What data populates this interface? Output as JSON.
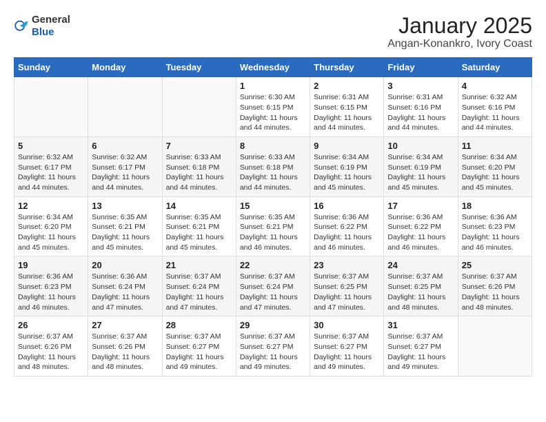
{
  "header": {
    "logo_general": "General",
    "logo_blue": "Blue",
    "title": "January 2025",
    "subtitle": "Angan-Konankro, Ivory Coast"
  },
  "weekdays": [
    "Sunday",
    "Monday",
    "Tuesday",
    "Wednesday",
    "Thursday",
    "Friday",
    "Saturday"
  ],
  "weeks": [
    [
      {
        "day": "",
        "info": ""
      },
      {
        "day": "",
        "info": ""
      },
      {
        "day": "",
        "info": ""
      },
      {
        "day": "1",
        "info": "Sunrise: 6:30 AM\nSunset: 6:15 PM\nDaylight: 11 hours\nand 44 minutes."
      },
      {
        "day": "2",
        "info": "Sunrise: 6:31 AM\nSunset: 6:15 PM\nDaylight: 11 hours\nand 44 minutes."
      },
      {
        "day": "3",
        "info": "Sunrise: 6:31 AM\nSunset: 6:16 PM\nDaylight: 11 hours\nand 44 minutes."
      },
      {
        "day": "4",
        "info": "Sunrise: 6:32 AM\nSunset: 6:16 PM\nDaylight: 11 hours\nand 44 minutes."
      }
    ],
    [
      {
        "day": "5",
        "info": "Sunrise: 6:32 AM\nSunset: 6:17 PM\nDaylight: 11 hours\nand 44 minutes."
      },
      {
        "day": "6",
        "info": "Sunrise: 6:32 AM\nSunset: 6:17 PM\nDaylight: 11 hours\nand 44 minutes."
      },
      {
        "day": "7",
        "info": "Sunrise: 6:33 AM\nSunset: 6:18 PM\nDaylight: 11 hours\nand 44 minutes."
      },
      {
        "day": "8",
        "info": "Sunrise: 6:33 AM\nSunset: 6:18 PM\nDaylight: 11 hours\nand 44 minutes."
      },
      {
        "day": "9",
        "info": "Sunrise: 6:34 AM\nSunset: 6:19 PM\nDaylight: 11 hours\nand 45 minutes."
      },
      {
        "day": "10",
        "info": "Sunrise: 6:34 AM\nSunset: 6:19 PM\nDaylight: 11 hours\nand 45 minutes."
      },
      {
        "day": "11",
        "info": "Sunrise: 6:34 AM\nSunset: 6:20 PM\nDaylight: 11 hours\nand 45 minutes."
      }
    ],
    [
      {
        "day": "12",
        "info": "Sunrise: 6:34 AM\nSunset: 6:20 PM\nDaylight: 11 hours\nand 45 minutes."
      },
      {
        "day": "13",
        "info": "Sunrise: 6:35 AM\nSunset: 6:21 PM\nDaylight: 11 hours\nand 45 minutes."
      },
      {
        "day": "14",
        "info": "Sunrise: 6:35 AM\nSunset: 6:21 PM\nDaylight: 11 hours\nand 45 minutes."
      },
      {
        "day": "15",
        "info": "Sunrise: 6:35 AM\nSunset: 6:21 PM\nDaylight: 11 hours\nand 46 minutes."
      },
      {
        "day": "16",
        "info": "Sunrise: 6:36 AM\nSunset: 6:22 PM\nDaylight: 11 hours\nand 46 minutes."
      },
      {
        "day": "17",
        "info": "Sunrise: 6:36 AM\nSunset: 6:22 PM\nDaylight: 11 hours\nand 46 minutes."
      },
      {
        "day": "18",
        "info": "Sunrise: 6:36 AM\nSunset: 6:23 PM\nDaylight: 11 hours\nand 46 minutes."
      }
    ],
    [
      {
        "day": "19",
        "info": "Sunrise: 6:36 AM\nSunset: 6:23 PM\nDaylight: 11 hours\nand 46 minutes."
      },
      {
        "day": "20",
        "info": "Sunrise: 6:36 AM\nSunset: 6:24 PM\nDaylight: 11 hours\nand 47 minutes."
      },
      {
        "day": "21",
        "info": "Sunrise: 6:37 AM\nSunset: 6:24 PM\nDaylight: 11 hours\nand 47 minutes."
      },
      {
        "day": "22",
        "info": "Sunrise: 6:37 AM\nSunset: 6:24 PM\nDaylight: 11 hours\nand 47 minutes."
      },
      {
        "day": "23",
        "info": "Sunrise: 6:37 AM\nSunset: 6:25 PM\nDaylight: 11 hours\nand 47 minutes."
      },
      {
        "day": "24",
        "info": "Sunrise: 6:37 AM\nSunset: 6:25 PM\nDaylight: 11 hours\nand 48 minutes."
      },
      {
        "day": "25",
        "info": "Sunrise: 6:37 AM\nSunset: 6:26 PM\nDaylight: 11 hours\nand 48 minutes."
      }
    ],
    [
      {
        "day": "26",
        "info": "Sunrise: 6:37 AM\nSunset: 6:26 PM\nDaylight: 11 hours\nand 48 minutes."
      },
      {
        "day": "27",
        "info": "Sunrise: 6:37 AM\nSunset: 6:26 PM\nDaylight: 11 hours\nand 48 minutes."
      },
      {
        "day": "28",
        "info": "Sunrise: 6:37 AM\nSunset: 6:27 PM\nDaylight: 11 hours\nand 49 minutes."
      },
      {
        "day": "29",
        "info": "Sunrise: 6:37 AM\nSunset: 6:27 PM\nDaylight: 11 hours\nand 49 minutes."
      },
      {
        "day": "30",
        "info": "Sunrise: 6:37 AM\nSunset: 6:27 PM\nDaylight: 11 hours\nand 49 minutes."
      },
      {
        "day": "31",
        "info": "Sunrise: 6:37 AM\nSunset: 6:27 PM\nDaylight: 11 hours\nand 49 minutes."
      },
      {
        "day": "",
        "info": ""
      }
    ]
  ]
}
